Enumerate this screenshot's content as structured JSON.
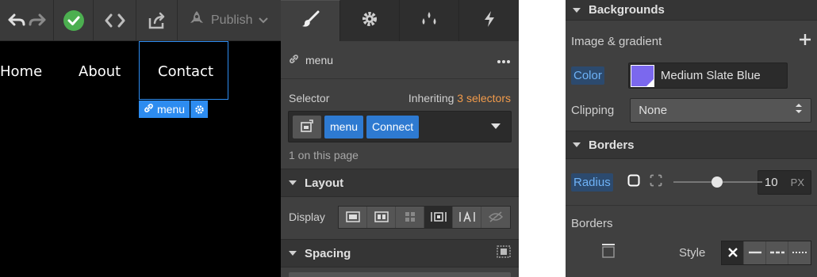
{
  "toolbar": {
    "publish_label": "Publish"
  },
  "canvas": {
    "nav_links": [
      "Home",
      "About",
      "Contact"
    ],
    "selected_tag": "menu"
  },
  "style_panel": {
    "element_name": "menu",
    "selector_label": "Selector",
    "inheriting_prefix": "Inheriting",
    "inheriting_link": "3 selectors",
    "chips": [
      "menu",
      "Connect"
    ],
    "on_page": "1 on this page",
    "layout_title": "Layout",
    "display_label": "Display",
    "spacing_title": "Spacing"
  },
  "right_panel": {
    "backgrounds_title": "Backgrounds",
    "image_gradient_label": "Image & gradient",
    "color_label": "Color",
    "color_value": "Medium Slate Blue",
    "color_hex": "#7b68ee",
    "clipping_label": "Clipping",
    "clipping_value": "None",
    "borders_title": "Borders",
    "radius_label": "Radius",
    "radius_value": "10",
    "radius_unit": "PX",
    "borders_label": "Borders",
    "style_label": "Style"
  },
  "colors": {
    "accent_blue": "#2d8cf0",
    "inherit_orange": "#f29b4b",
    "publish_green": "#4caf50"
  }
}
